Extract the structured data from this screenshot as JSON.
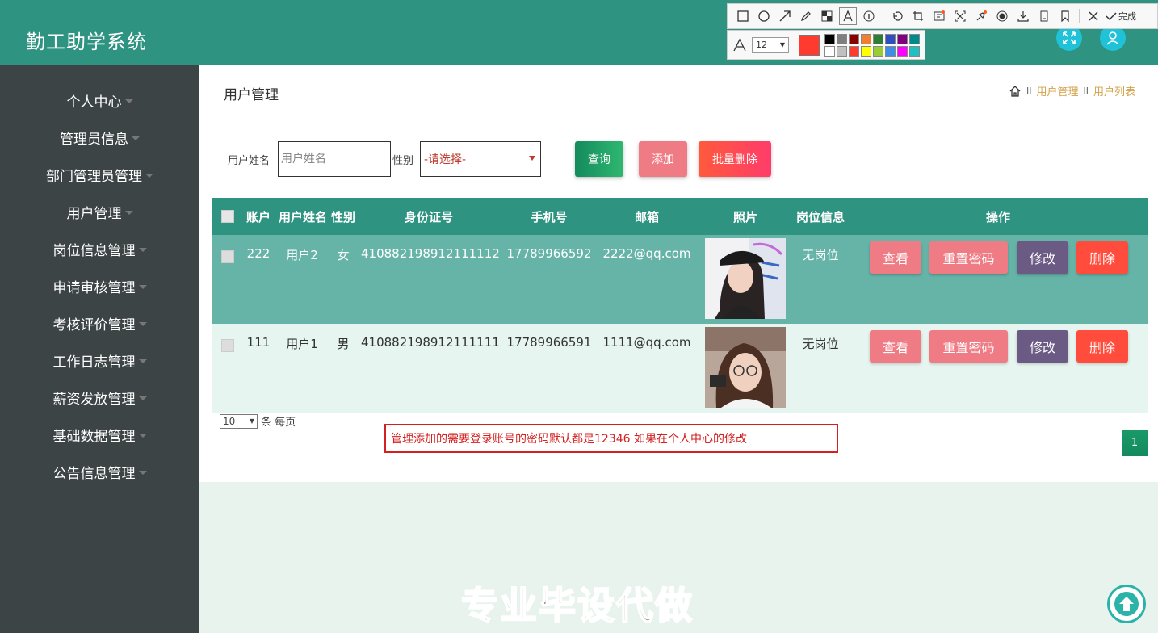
{
  "header": {
    "title": "勤工助学系统",
    "icons": [
      "fullscreen-icon",
      "user-icon"
    ]
  },
  "snip_toolbar": {
    "tools": [
      "rectangle",
      "ellipse",
      "arrow",
      "pen",
      "mosaic",
      "text",
      "number",
      "undo",
      "crop",
      "ocr",
      "scan",
      "pin",
      "record",
      "download",
      "long-screenshot",
      "bookmark",
      "close"
    ],
    "done_label": "完成",
    "font_size": "12",
    "current_color": "#ff3b30",
    "palette": [
      "#000000",
      "#7f7f7f",
      "#8b0000",
      "#f08030",
      "#2e7d32",
      "#2f4fbf",
      "#800080",
      "#008b8b",
      "#ffffff",
      "#c0c0c0",
      "#ff3b30",
      "#ffff00",
      "#9acd32",
      "#3c8ee6",
      "#ff00ff",
      "#20c0c0"
    ]
  },
  "sidebar": {
    "items": [
      {
        "label": "个人中心"
      },
      {
        "label": "管理员信息"
      },
      {
        "label": "部门管理员管理"
      },
      {
        "label": "用户管理"
      },
      {
        "label": "岗位信息管理"
      },
      {
        "label": "申请审核管理"
      },
      {
        "label": "考核评价管理"
      },
      {
        "label": "工作日志管理"
      },
      {
        "label": "薪资发放管理"
      },
      {
        "label": "基础数据管理"
      },
      {
        "label": "公告信息管理"
      }
    ]
  },
  "main": {
    "heading": "用户管理",
    "breadcrumb": [
      "用户管理",
      "用户列表"
    ],
    "breadcrumb_sep": "II",
    "search": {
      "name_label": "用户姓名",
      "name_placeholder": "用户姓名",
      "gender_label": "性别",
      "gender_selected": "-请选择-"
    },
    "buttons": {
      "query": "查询",
      "add": "添加",
      "batch_delete": "批量删除"
    },
    "table": {
      "headers": [
        "账户",
        "用户姓名",
        "性别",
        "身份证号",
        "手机号",
        "邮箱",
        "照片",
        "岗位信息",
        "操作"
      ],
      "rows": [
        {
          "account": "222",
          "name": "用户2",
          "gender": "女",
          "id_card": "410882198912111112",
          "phone": "17789966592",
          "email": "2222@qq.com",
          "job": "无岗位"
        },
        {
          "account": "111",
          "name": "用户1",
          "gender": "男",
          "id_card": "410882198912111111",
          "phone": "17789966591",
          "email": "1111@qq.com",
          "job": "无岗位"
        }
      ],
      "actions": {
        "view": "查看",
        "reset_password": "重置密码",
        "edit": "修改",
        "delete": "删除"
      }
    },
    "pagination": {
      "page_size": "10",
      "per_page_label": "条 每页",
      "current_page": "1"
    },
    "note": "管理添加的需要登录账号的密码默认都是12346 如果在个人中心的修改"
  },
  "watermark": "专业毕设代做"
}
